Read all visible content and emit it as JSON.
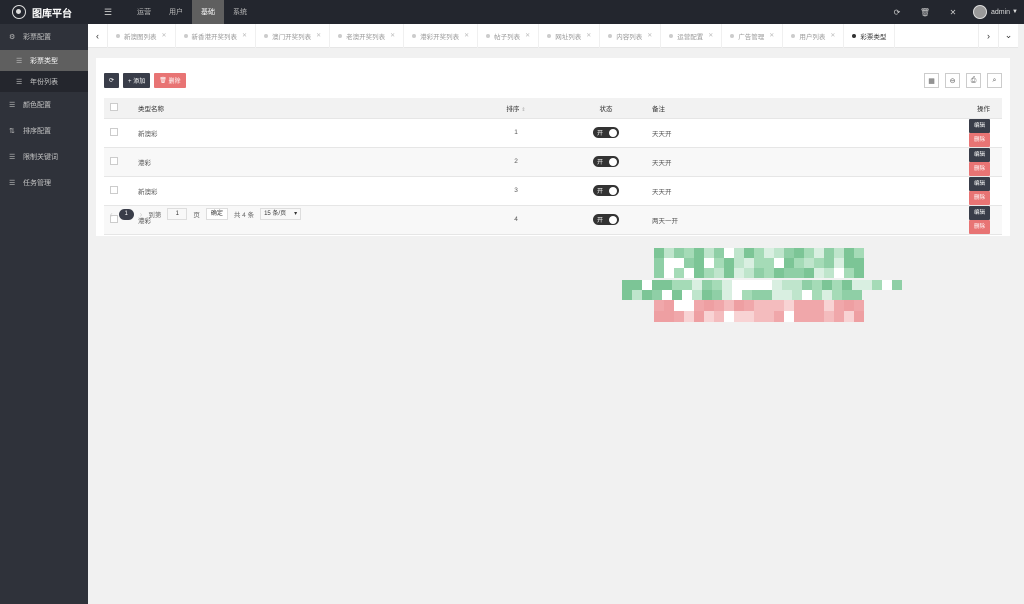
{
  "app": {
    "title": "图库平台"
  },
  "top_nav": [
    {
      "label": "运营",
      "active": false
    },
    {
      "label": "用户",
      "active": false
    },
    {
      "label": "基础",
      "active": true
    },
    {
      "label": "系统",
      "active": false
    }
  ],
  "user": {
    "name": "admin"
  },
  "sidebar": {
    "items": [
      {
        "icon": "gear-icon",
        "label": "彩票配置"
      },
      {
        "icon": "list-icon",
        "label": "彩票类型",
        "active": true,
        "sub": true
      },
      {
        "icon": "list-icon",
        "label": "年份列表",
        "sub": true
      },
      {
        "icon": "list-icon",
        "label": "颜色配置"
      },
      {
        "icon": "sort-icon",
        "label": "排序配置"
      },
      {
        "icon": "list-icon",
        "label": "限制关键词"
      },
      {
        "icon": "list-icon",
        "label": "任务管理"
      }
    ]
  },
  "tabs": [
    {
      "label": "新澳图列表",
      "active": false
    },
    {
      "label": "新香港开奖列表",
      "active": false
    },
    {
      "label": "澳门开奖列表",
      "active": false
    },
    {
      "label": "老澳开奖列表",
      "active": false
    },
    {
      "label": "港彩开奖列表",
      "active": false
    },
    {
      "label": "帖子列表",
      "active": false
    },
    {
      "label": "网址列表",
      "active": false
    },
    {
      "label": "内容列表",
      "active": false
    },
    {
      "label": "运营配置",
      "active": false
    },
    {
      "label": "广告管理",
      "active": false
    },
    {
      "label": "用户列表",
      "active": false
    },
    {
      "label": "彩票类型",
      "active": true
    }
  ],
  "toolbar": {
    "refresh_icon": "refresh-icon",
    "add_label": "+ 添加",
    "delete_label": "删除"
  },
  "table": {
    "headers": {
      "name": "类型名称",
      "sort": "排序",
      "status": "状态",
      "note": "备注",
      "ops": "操作"
    },
    "rows": [
      {
        "name": "新澳彩",
        "sort": "1",
        "status": "开",
        "note": "天天开"
      },
      {
        "name": "港彩",
        "sort": "2",
        "status": "开",
        "note": "天天开"
      },
      {
        "name": "新澳彩",
        "sort": "3",
        "status": "开",
        "note": "天天开"
      },
      {
        "name": "港彩",
        "sort": "4",
        "status": "开",
        "note": "两天一开"
      }
    ],
    "edit_label": "编辑",
    "delete_label": "删除"
  },
  "pager": {
    "current": "1",
    "goto_label": "到第",
    "goto_value": "1",
    "page_unit": "页",
    "confirm": "确定",
    "total": "共 4 条",
    "page_size": "15 条/页"
  },
  "colors": {
    "topbar": "#23262e",
    "sidebar": "#2f323a",
    "accent_dark": "#393d49",
    "danger": "#e87474"
  }
}
